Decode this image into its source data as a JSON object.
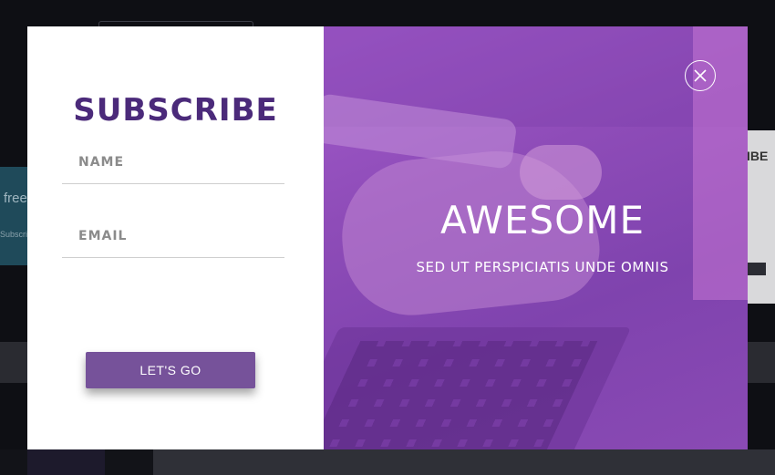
{
  "background": {
    "left_partial_text": "free",
    "left_small_text": "Subscri",
    "right_partial_text": "IBE"
  },
  "modal": {
    "form": {
      "title": "SUBSCRIBE",
      "name_placeholder": "NAME",
      "email_placeholder": "EMAIL",
      "submit_label": "LET'S GO"
    },
    "promo": {
      "headline": "AWESOME",
      "subheadline": "SED UT PERSPICIATIS UNDE OMNIS",
      "close_icon": "close-icon"
    }
  },
  "colors": {
    "title": "#4b2a7a",
    "button": "#76529a",
    "overlay_purple": "#8e4cb8"
  }
}
